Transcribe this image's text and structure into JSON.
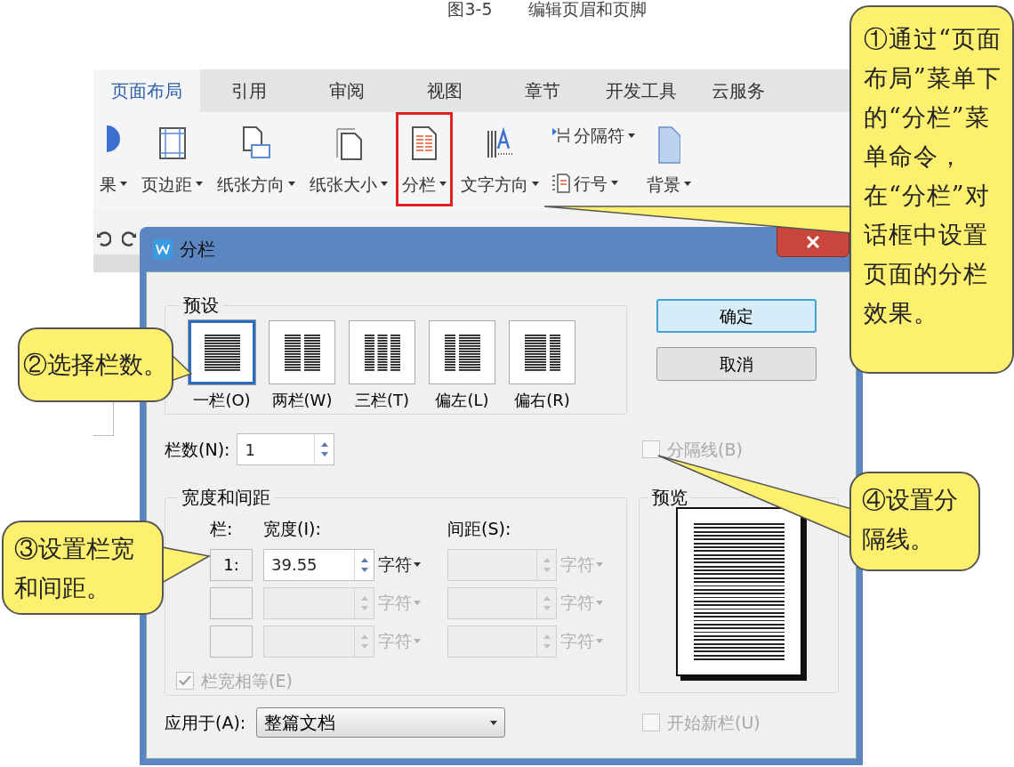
{
  "caption": {
    "number": "图3-5",
    "title": "编辑页眉和页脚"
  },
  "ribbon": {
    "tabs": [
      {
        "label": "页面布局",
        "selected": true
      },
      {
        "label": "引用",
        "selected": false
      },
      {
        "label": "审阅",
        "selected": false
      },
      {
        "label": "视图",
        "selected": false
      },
      {
        "label": "章节",
        "selected": false
      },
      {
        "label": "开发工具",
        "selected": false
      },
      {
        "label": "云服务",
        "selected": false
      }
    ],
    "tools": [
      {
        "kind": "large",
        "label": "果",
        "highlighted": false
      },
      {
        "kind": "large",
        "label": "页边距",
        "highlighted": false
      },
      {
        "kind": "large",
        "label": "纸张方向",
        "highlighted": false
      },
      {
        "kind": "large",
        "label": "纸张大小",
        "highlighted": false
      },
      {
        "kind": "large",
        "label": "分栏",
        "highlighted": true
      },
      {
        "kind": "large",
        "label": "文字方向",
        "highlighted": false
      },
      {
        "kind": "stack",
        "items": [
          {
            "label": "分隔符"
          },
          {
            "label": "行号"
          }
        ]
      },
      {
        "kind": "large",
        "label": "背景",
        "highlighted": false
      }
    ]
  },
  "dialog": {
    "title": "分栏",
    "presets_title": "预设",
    "presets": [
      {
        "label": "一栏(O)",
        "selected": true
      },
      {
        "label": "两栏(W)",
        "selected": false
      },
      {
        "label": "三栏(T)",
        "selected": false
      },
      {
        "label": "偏左(L)",
        "selected": false
      },
      {
        "label": "偏右(R)",
        "selected": false
      }
    ],
    "buttons": [
      {
        "label": "确定",
        "default": true
      },
      {
        "label": "取消",
        "default": false
      }
    ],
    "column_count": {
      "label": "栏数(N):",
      "value": "1"
    },
    "separator": {
      "label": "分隔线(B)",
      "checked": false,
      "disabled": true
    },
    "width_spacing": {
      "title": "宽度和间距",
      "headers": [
        "栏:",
        "宽度(I):",
        "间距(S):"
      ],
      "rows": [
        {
          "number": "1:",
          "width": {
            "value": "39.55",
            "unit": "字符",
            "disabled": false
          },
          "spacing": {
            "unit": "字符",
            "disabled": true
          }
        },
        {
          "width": {
            "unit": "字符",
            "disabled": true
          },
          "spacing": {
            "unit": "字符",
            "disabled": true
          }
        },
        {
          "width": {
            "unit": "字符",
            "disabled": true
          },
          "spacing": {
            "unit": "字符",
            "disabled": true
          }
        }
      ]
    },
    "equal_width": {
      "label": "栏宽相等(E)",
      "checked": true,
      "disabled": true
    },
    "preview": {
      "title": "预览"
    },
    "apply_to": {
      "label": "应用于(A):",
      "value": "整篇文档"
    },
    "new_column": {
      "label": "开始新栏(U)",
      "checked": false,
      "disabled": true
    }
  },
  "callouts": [
    {
      "text": "①通过“页面布局”菜单下的“分栏”菜单命令，在“分栏”对话框中设置页面的分栏效果。"
    },
    {
      "text": "②选择栏数。"
    },
    {
      "text": "③设置栏宽和间距。"
    },
    {
      "text": "④设置分隔线。"
    }
  ]
}
